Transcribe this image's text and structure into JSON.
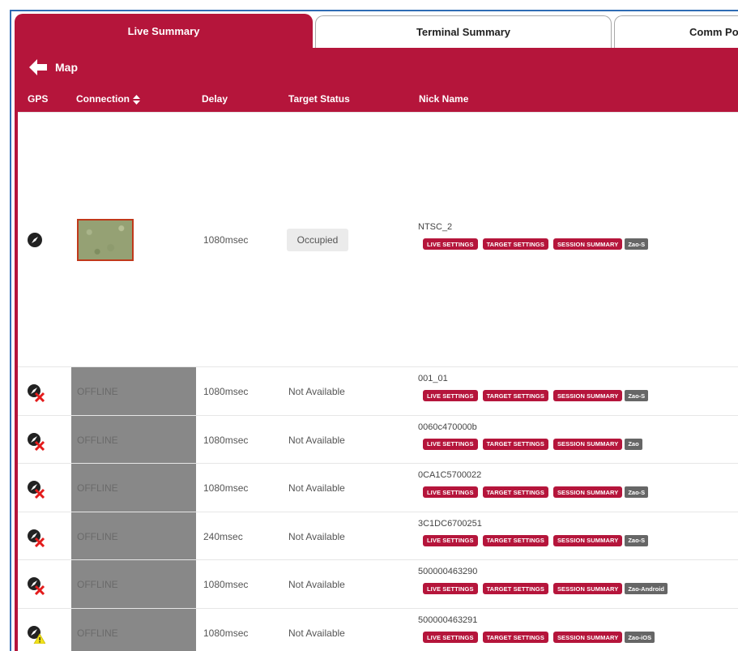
{
  "tabs": [
    {
      "label": "Live Summary"
    },
    {
      "label": "Terminal Summary"
    },
    {
      "label": "Comm Po"
    }
  ],
  "toolbar": {
    "back_label": "Map"
  },
  "columns": {
    "gps": "GPS",
    "connection": "Connection",
    "delay": "Delay",
    "target_status": "Target Status",
    "nick_name": "Nick Name"
  },
  "action_labels": {
    "live_settings": "LIVE SETTINGS",
    "target_settings": "TARGET SETTINGS",
    "session_summary": "SESSION SUMMARY"
  },
  "colors": {
    "accent": "#b5153b",
    "offline": "#888888",
    "tag": "#666666"
  },
  "rows": [
    {
      "gps_icon": "compass-icon",
      "connection": "",
      "delay": "1080msec",
      "status": "Occupied",
      "nick": "NTSC_2",
      "device": "Zao-S"
    },
    {
      "gps_icon": "gps-off-icon",
      "connection": "OFFLINE",
      "delay": "1080msec",
      "status": "Not Available",
      "nick": "001_01",
      "device": "Zao-S"
    },
    {
      "gps_icon": "gps-off-icon",
      "connection": "OFFLINE",
      "delay": "1080msec",
      "status": "Not Available",
      "nick": "0060c470000b",
      "device": "Zao"
    },
    {
      "gps_icon": "gps-off-icon",
      "connection": "OFFLINE",
      "delay": "1080msec",
      "status": "Not Available",
      "nick": "0CA1C5700022",
      "device": "Zao-S"
    },
    {
      "gps_icon": "gps-off-icon",
      "connection": "OFFLINE",
      "delay": "240msec",
      "status": "Not Available",
      "nick": "3C1DC6700251",
      "device": "Zao-S"
    },
    {
      "gps_icon": "gps-off-icon",
      "connection": "OFFLINE",
      "delay": "1080msec",
      "status": "Not Available",
      "nick": "500000463290",
      "device": "Zao-Android"
    },
    {
      "gps_icon": "gps-warning-icon",
      "connection": "OFFLINE",
      "delay": "1080msec",
      "status": "Not Available",
      "nick": "500000463291",
      "device": "Zao-iOS"
    }
  ]
}
